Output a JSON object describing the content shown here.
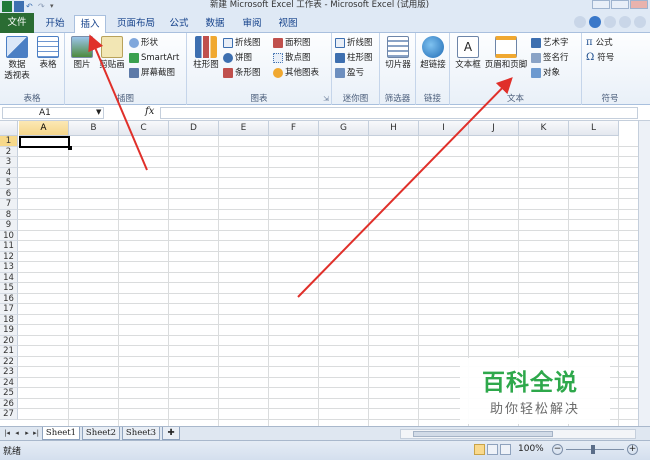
{
  "window": {
    "title": "新建 Microsoft Excel 工作表 - Microsoft Excel (试用版)"
  },
  "tabs": [
    "文件",
    "开始",
    "插入",
    "页面布局",
    "公式",
    "数据",
    "审阅",
    "视图"
  ],
  "active_tab": "插入",
  "ribbon": {
    "groups": {
      "tables": "表格",
      "illustrations": "插图",
      "charts": "图表",
      "sparklines": "迷你图",
      "filter": "筛选器",
      "links": "链接",
      "text": "文本",
      "symbols": "符号"
    },
    "pivot_line1": "数据",
    "pivot_line2": "透视表",
    "table": "表格",
    "picture": "图片",
    "clipart": "剪贴画",
    "shapes": "形状",
    "smartart": "SmartArt",
    "screenshot": "屏幕截图",
    "column_chart": "柱形图",
    "line_chart": "折线图",
    "pie_chart": "饼图",
    "bar_chart": "条形图",
    "area_chart": "面积图",
    "scatter_chart": "散点图",
    "other_chart": "其他图表",
    "spark_line": "折线图",
    "spark_column": "柱形图",
    "spark_winloss": "盈亏",
    "slicer": "切片器",
    "hyperlink": "超链接",
    "textbox": "文本框",
    "header_footer": "页眉和页脚",
    "wordart": "艺术字",
    "signature": "签名行",
    "object": "对象",
    "equation": "公式",
    "symbol": "符号"
  },
  "formula_bar": {
    "name_box": "A1",
    "fx": "fx",
    "value": ""
  },
  "columns": [
    "A",
    "B",
    "C",
    "D",
    "E",
    "F",
    "G",
    "H",
    "I",
    "J",
    "K",
    "L"
  ],
  "rows": [
    "1",
    "2",
    "3",
    "4",
    "5",
    "6",
    "7",
    "8",
    "9",
    "10",
    "11",
    "12",
    "13",
    "14",
    "15",
    "16",
    "17",
    "18",
    "19",
    "20",
    "21",
    "22",
    "23",
    "24",
    "25",
    "26",
    "27"
  ],
  "active_cell": "A1",
  "sheets": [
    "Sheet1",
    "Sheet2",
    "Sheet3"
  ],
  "status": {
    "text": "就绪",
    "zoom": "100%"
  },
  "watermark": {
    "main": "百科全说",
    "sub": "助你轻松解决"
  },
  "colors": {
    "file_tab": "#2a6c33",
    "annotation_arrow": "#e0302a",
    "watermark_green": "#2ea84b"
  }
}
